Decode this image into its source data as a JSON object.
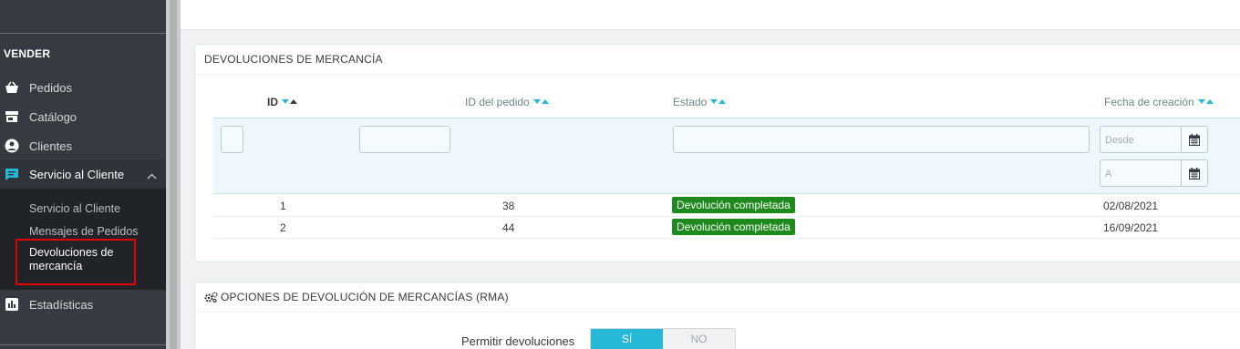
{
  "sidebar": {
    "section": "VENDER",
    "items": [
      {
        "label": "Pedidos",
        "icon": "basket-icon"
      },
      {
        "label": "Catálogo",
        "icon": "store-icon"
      },
      {
        "label": "Clientes",
        "icon": "user-circle-icon"
      },
      {
        "label": "Servicio al Cliente",
        "icon": "chat-icon"
      },
      {
        "label": "Estadísticas",
        "icon": "bar-chart-icon"
      }
    ],
    "subitems": [
      {
        "label": "Servicio al Cliente"
      },
      {
        "label": "Mensajes de Pedidos"
      },
      {
        "label_line1": "Devoluciones de",
        "label_line2": "mercancía"
      }
    ]
  },
  "returns_panel": {
    "title": "DEVOLUCIONES DE MERCANCÍA",
    "columns": {
      "id": "ID",
      "order_id": "ID del pedido",
      "status": "Estado",
      "date": "Fecha de creación"
    },
    "filters": {
      "date_from_placeholder": "Desde",
      "date_to_placeholder": "A"
    },
    "rows": [
      {
        "id": "1",
        "order_id": "38",
        "status": "Devolución completada",
        "date": "02/08/2021"
      },
      {
        "id": "2",
        "order_id": "44",
        "status": "Devolución completada",
        "date": "16/09/2021"
      }
    ]
  },
  "options_panel": {
    "title": "OPCIONES DE DEVOLUCIÓN DE MERCANCÍAS (RMA)",
    "allow_label": "Permitir devoluciones",
    "yes_label": "SÍ",
    "no_label": "NO",
    "selected": "SÍ"
  },
  "colors": {
    "sidebar_bg": "#363a41",
    "accent": "#25b9d7",
    "status_success": "#1e8a1e",
    "highlight": "#e60000"
  }
}
